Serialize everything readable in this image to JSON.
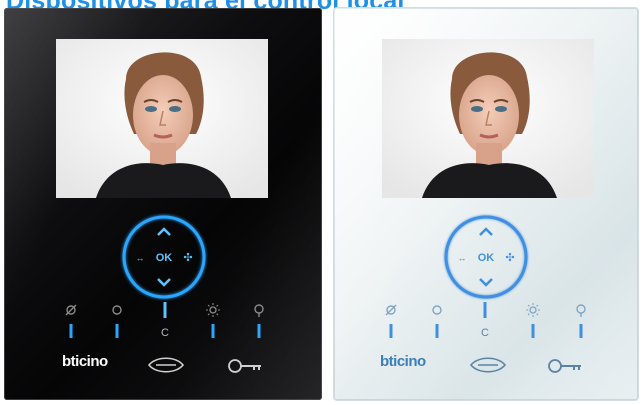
{
  "header": {
    "title": "Dispositivos para el control local"
  },
  "devices": [
    {
      "variant": "black",
      "brand": "bticino",
      "button_letter": "C",
      "dpad_center": "OK",
      "glow_color": "#2aa6ff",
      "icons": [
        "mute-icon",
        "circle-icon",
        "door-icon",
        "sun-icon",
        "favourite-icon",
        "speaker-icon",
        "key-icon"
      ]
    },
    {
      "variant": "white",
      "brand": "bticino",
      "button_letter": "C",
      "dpad_center": "OK",
      "glow_color": "#3f8fe0",
      "icons": [
        "mute-icon",
        "circle-icon",
        "door-icon",
        "sun-icon",
        "favourite-icon",
        "speaker-icon",
        "key-icon"
      ]
    }
  ],
  "colors": {
    "title": "#1e90e6",
    "black_panel": "#0a0a0c",
    "white_panel": "#eef3f4",
    "glow": "#2aa6ff"
  }
}
